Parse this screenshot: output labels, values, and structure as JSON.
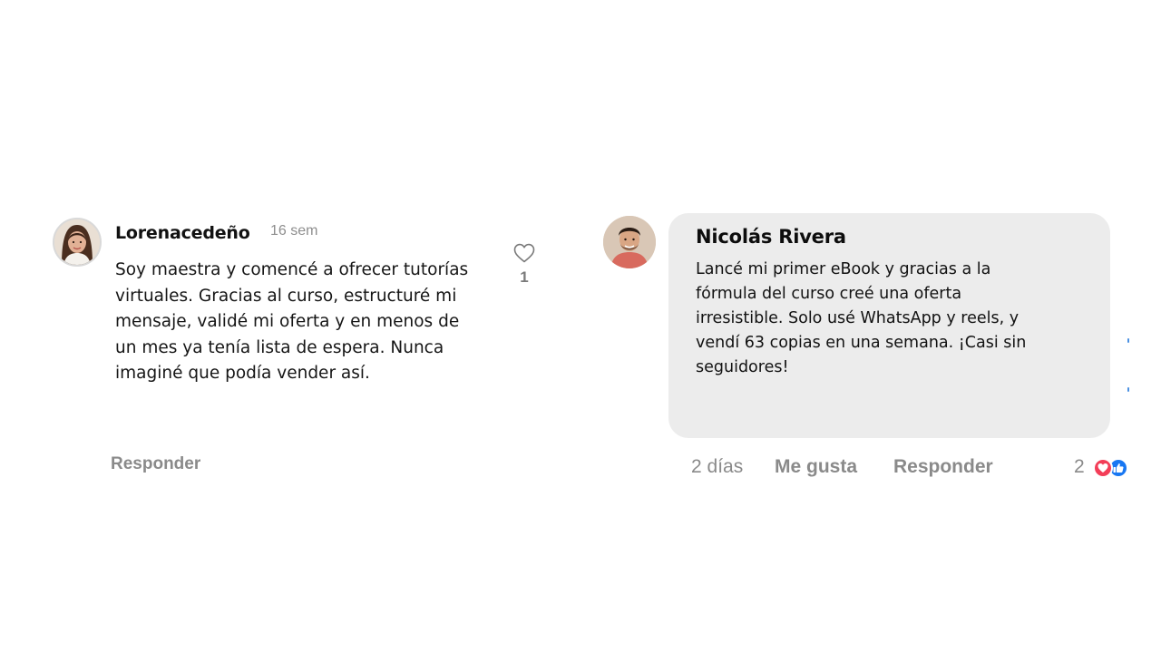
{
  "left_comment": {
    "username": "Lorenacedeño",
    "timestamp": "16 sem",
    "text": "Soy maestra y comencé a ofrecer tutorías\nvirtuales. Gracias al curso, estructuré mi\nmensaje, validé mi oferta y en menos de\nun mes ya tenía lista de espera. Nunca\nimaginé que podía vender así.",
    "like_count": "1",
    "like_icon": "heart-outline-icon",
    "reply_label": "Responder"
  },
  "right_comment": {
    "name": "Nicolás Rivera",
    "text": "Lancé mi primer eBook y gracias a la\nfórmula del curso creé una oferta\nirresistible. Solo usé WhatsApp y reels, y\nvendí 63 copias en una semana. ¡Casi sin\nseguidores!",
    "time": "2 días",
    "like_label": "Me gusta",
    "reply_label": "Responder",
    "reaction_count": "2",
    "reactions": [
      "love-reaction-icon",
      "like-reaction-icon"
    ],
    "bubble_color": "#ececec"
  },
  "colors": {
    "muted_text": "#8a8a8a",
    "heart_reaction": "#f33e58",
    "like_reaction": "#1877f2"
  }
}
